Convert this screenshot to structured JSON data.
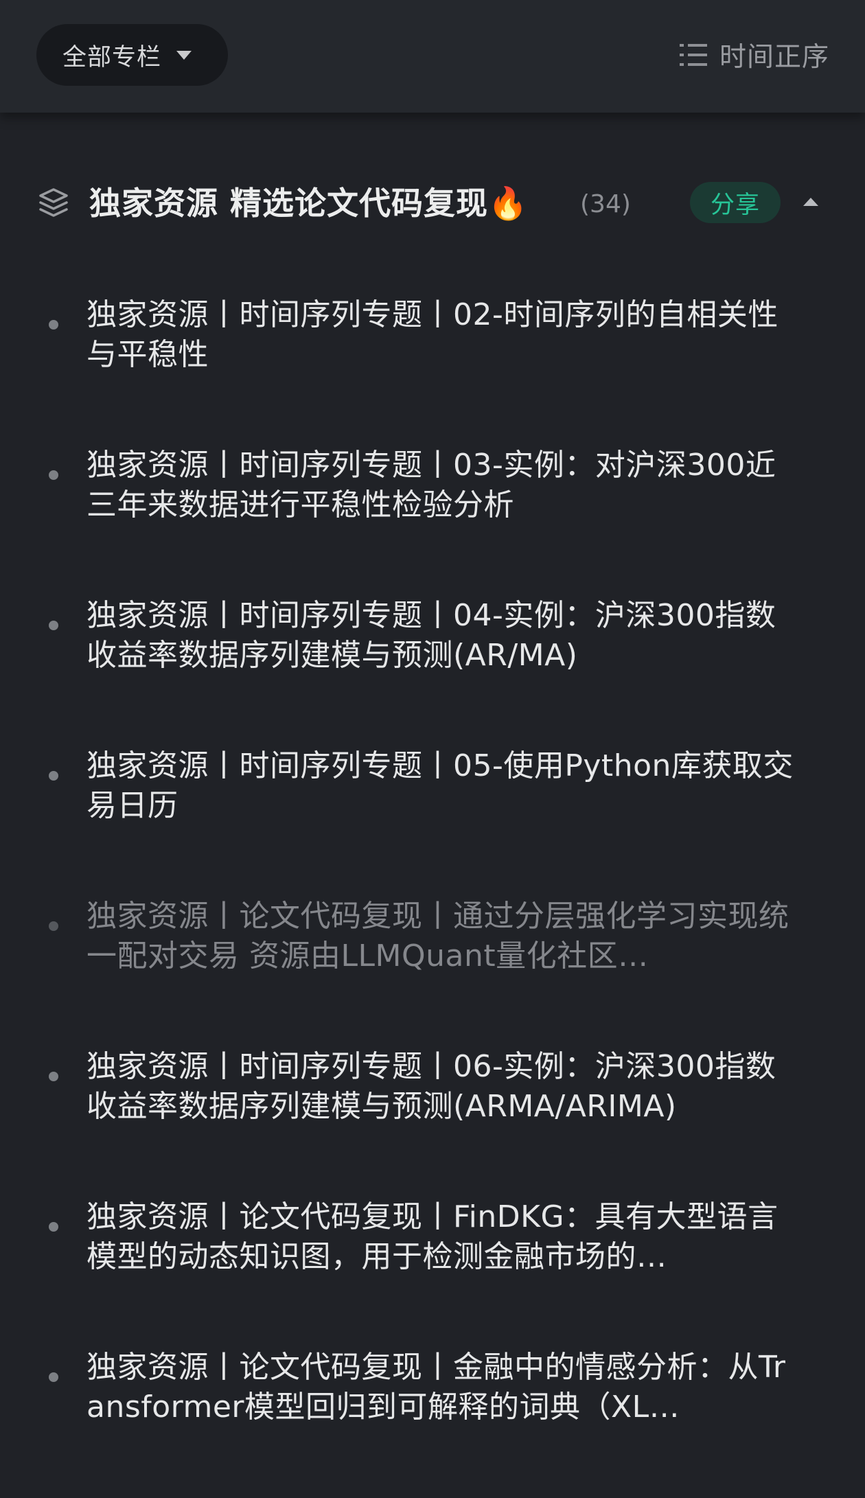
{
  "topbar": {
    "filter_label": "全部专栏",
    "filter_icon": "caret-down-icon",
    "sort_label": "时间正序",
    "sort_icon": "list-order-icon"
  },
  "section": {
    "icon": "layers-stack-icon",
    "title": "独家资源 精选论文代码复现🔥",
    "count": "(34)",
    "share_label": "分享",
    "collapse_icon": "caret-up-icon",
    "colors": {
      "share_text": "#27c497",
      "share_bg": "#1b3a33"
    }
  },
  "articles": [
    {
      "title": "独家资源丨时间序列专题丨02-时间序列的自相关性与平稳性",
      "read": false
    },
    {
      "title": "独家资源丨时间序列专题丨03-实例：对沪深300近三年来数据进行平稳性检验分析",
      "read": false
    },
    {
      "title": "独家资源丨时间序列专题丨04-实例：沪深300指数收益率数据序列建模与预测(AR/MA)",
      "read": false
    },
    {
      "title": "独家资源丨时间序列专题丨05-使用Python库获取交易日历",
      "read": false
    },
    {
      "title": "独家资源丨论文代码复现丨通过分层强化学习实现统一配对交易 资源由LLMQuant量化社区…",
      "read": true
    },
    {
      "title": "独家资源丨时间序列专题丨06-实例：沪深300指数收益率数据序列建模与预测(ARMA/ARIMA)",
      "read": false
    },
    {
      "title": "独家资源丨论文代码复现丨FinDKG：具有大型语言模型的动态知识图，用于检测金融市场的…",
      "read": false
    },
    {
      "title": "独家资源丨论文代码复现丨金融中的情感分析：从Transformer模型回归到可解释的词典（XL…",
      "read": false
    }
  ]
}
